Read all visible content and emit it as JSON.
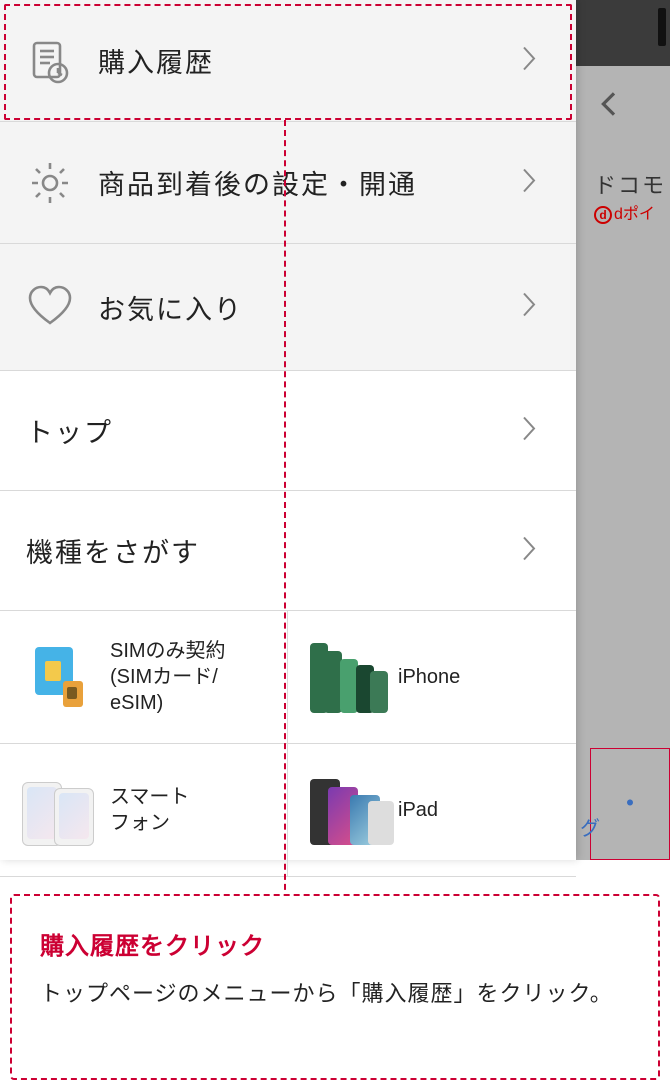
{
  "menu": {
    "purchase_history": "購入履歴",
    "post_delivery_setup": "商品到着後の設定・開通",
    "favorites": "お気に入り",
    "top": "トップ",
    "find_model": "機種をさがす"
  },
  "grid": {
    "sim_only": "SIMのみ契約\n(SIMカード/\neSIM)",
    "iphone": "iPhone",
    "smartphone": "スマート\nフォン",
    "ipad": "iPad"
  },
  "background": {
    "brand_fragment": "ドコモ",
    "dpoint_fragment": "dポイ",
    "blue_fragment": "グ"
  },
  "callout": {
    "title": "購入履歴をクリック",
    "body": "トップページのメニューから「購入履歴」をクリック。"
  },
  "icons": {
    "purchase_history": "document-clock-icon",
    "settings": "gear-icon",
    "favorites": "heart-icon",
    "chevron_right": "chevron-right-icon",
    "back": "chevron-left-icon"
  },
  "colors": {
    "accent": "#cc0033",
    "divider": "#d9d9d9",
    "tinted_bg": "#f4f4f4",
    "chevron": "#888888"
  }
}
